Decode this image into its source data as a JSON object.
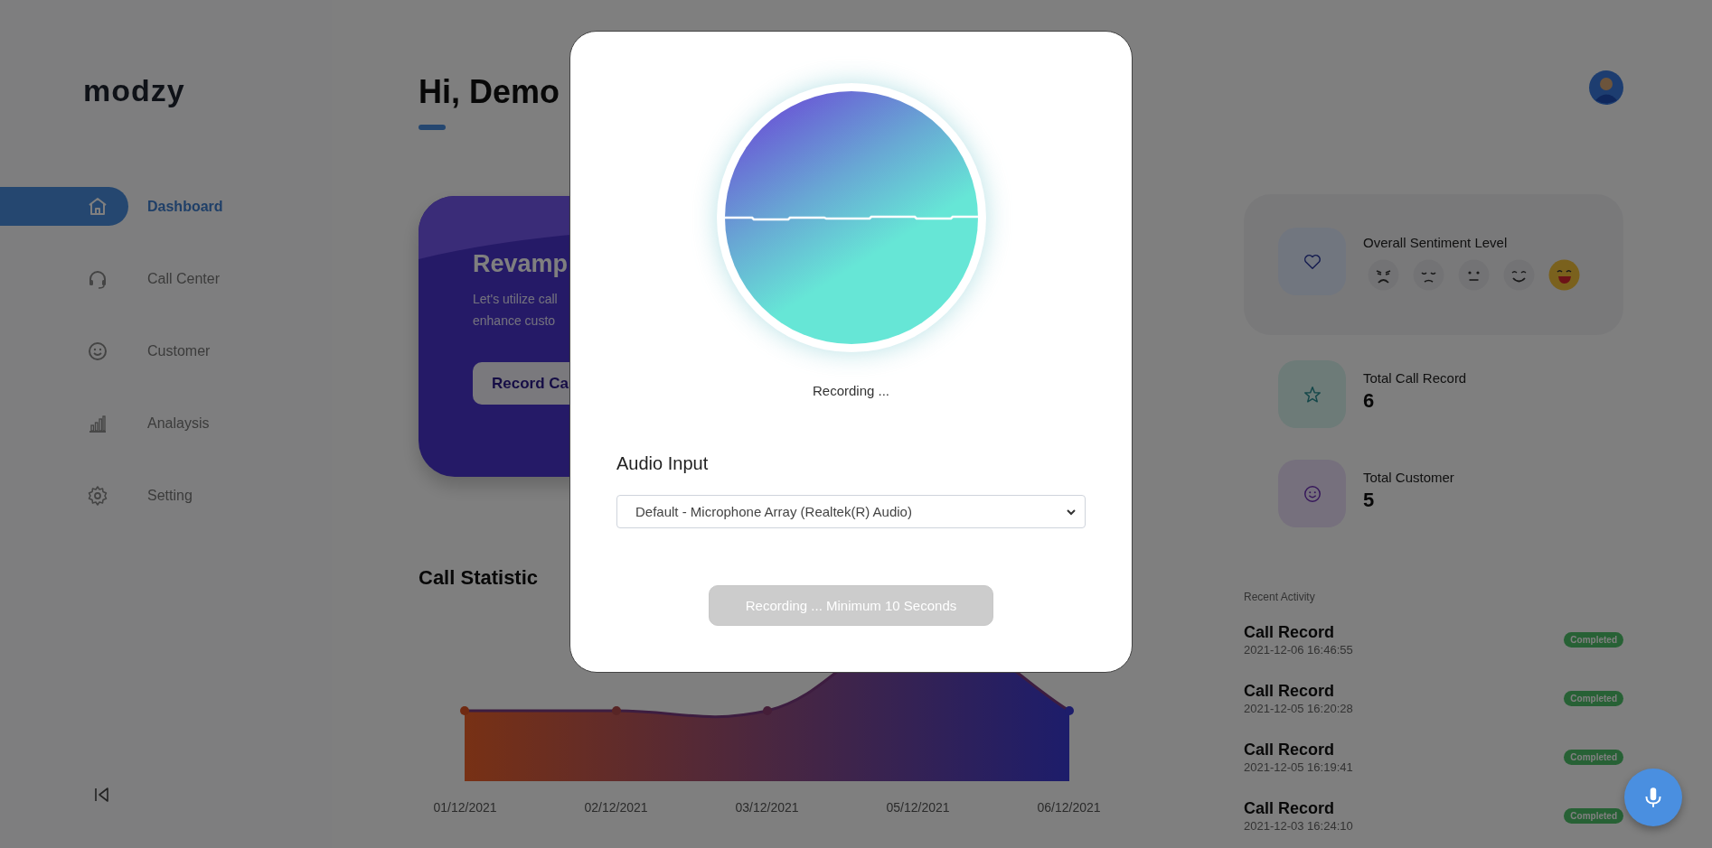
{
  "logo": "modzy",
  "sidebar": {
    "items": [
      {
        "label": "Dashboard",
        "selected": true
      },
      {
        "label": "Call Center",
        "selected": false
      },
      {
        "label": "Customer",
        "selected": false
      },
      {
        "label": "Analaysis",
        "selected": false
      },
      {
        "label": "Setting",
        "selected": false
      }
    ]
  },
  "greeting": "Hi, Demo",
  "banner": {
    "title": "Revamp",
    "description_lines": [
      "Let's utilize call",
      "enhance custo"
    ],
    "button": "Record Ca"
  },
  "call_statistic": {
    "title": "Call Statistic",
    "x_labels": [
      "01/12/2021",
      "02/12/2021",
      "03/12/2021",
      "05/12/2021",
      "06/12/2021"
    ]
  },
  "sentiment": {
    "label": "Overall Sentiment Level",
    "levels": [
      {
        "selected": false
      },
      {
        "selected": false
      },
      {
        "selected": false
      },
      {
        "selected": false
      },
      {
        "selected": true
      }
    ]
  },
  "stats": [
    {
      "label": "Total Call Record",
      "value": "6"
    },
    {
      "label": "Total Customer",
      "value": "5"
    }
  ],
  "recent_activity": {
    "title": "Recent Activity",
    "items": [
      {
        "title": "Call Record",
        "time": "2021-12-06 16:46:55",
        "status": "Completed"
      },
      {
        "title": "Call Record",
        "time": "2021-12-05 16:20:28",
        "status": "Completed"
      },
      {
        "title": "Call Record",
        "time": "2021-12-05 16:19:41",
        "status": "Completed"
      },
      {
        "title": "Call Record",
        "time": "2021-12-03 16:24:10",
        "status": "Completed"
      }
    ]
  },
  "modal": {
    "status": "Recording ...",
    "audio_input_label": "Audio Input",
    "audio_input_value": "Default - Microphone Array (Realtek(R) Audio)",
    "button": {
      "label": "Recording ... Minimum 10 Seconds",
      "disabled": true
    }
  }
}
